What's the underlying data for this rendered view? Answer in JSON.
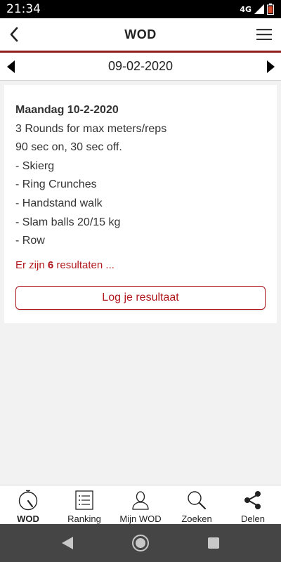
{
  "status": {
    "time": "21:34",
    "network": "4G"
  },
  "header": {
    "title": "WOD"
  },
  "date_nav": {
    "date": "09-02-2020"
  },
  "wod": {
    "title": "Maandag 10-2-2020",
    "lines": [
      "3 Rounds for max meters/reps",
      "90 sec on, 30 sec off.",
      "- Skierg",
      "- Ring Crunches",
      "- Handstand walk",
      "- Slam balls 20/15 kg",
      "- Row"
    ],
    "results_prefix": "Er zijn ",
    "results_count": "6",
    "results_suffix": " resultaten ...",
    "log_button": "Log je resultaat"
  },
  "tabs": [
    {
      "label": "WOD",
      "icon": "stopwatch-icon",
      "active": true
    },
    {
      "label": "Ranking",
      "icon": "list-icon",
      "active": false
    },
    {
      "label": "Mijn WOD",
      "icon": "person-icon",
      "active": false
    },
    {
      "label": "Zoeken",
      "icon": "search-icon",
      "active": false
    },
    {
      "label": "Delen",
      "icon": "share-icon",
      "active": false
    }
  ],
  "colors": {
    "accent": "#b0191e",
    "accent_line": "#8f1d1d",
    "background": "#f2f2f2",
    "nav_bar": "#454545"
  }
}
